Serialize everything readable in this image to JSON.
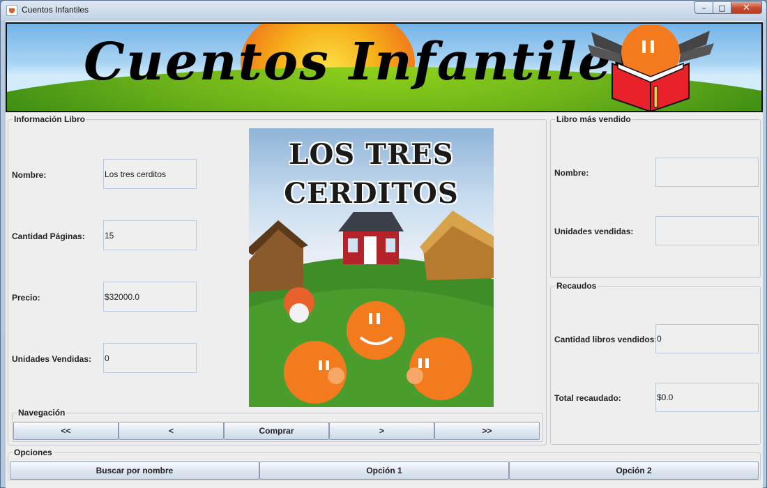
{
  "window": {
    "title": "Cuentos Infantiles",
    "minimize": "–",
    "maximize": "□",
    "close": "✕"
  },
  "banner": {
    "title": "Cuentos Infantiles"
  },
  "info": {
    "title": "Información Libro",
    "fields": [
      {
        "label": "Nombre:",
        "value": "Los tres cerditos"
      },
      {
        "label": "Cantidad Páginas:",
        "value": "15"
      },
      {
        "label": "Precio:",
        "value": "$32000.0"
      },
      {
        "label": "Unidades Vendidas:",
        "value": "0"
      }
    ],
    "cover_title_line1": "LOS TRES",
    "cover_title_line2": "CERDITOS"
  },
  "navigation": {
    "title": "Navegación",
    "buttons": [
      "<<",
      "<",
      "Comprar",
      ">",
      ">>"
    ]
  },
  "best_seller": {
    "title": "Libro más vendido",
    "name_label": "Nombre:",
    "name_value": "",
    "units_label": "Unidades vendidas:",
    "units_value": ""
  },
  "earnings": {
    "title": "Recaudos",
    "count_label": "Cantidad libros vendidos:",
    "count_value": "0",
    "total_label": "Total recaudado:",
    "total_value": "$0.0"
  },
  "options": {
    "title": "Opciones",
    "buttons": [
      "Buscar por nombre",
      "Opción 1",
      "Opción 2"
    ]
  },
  "colors": {
    "accent_orange": "#f47a1e",
    "book_red": "#e8212b",
    "grass": "#3e8d14"
  }
}
